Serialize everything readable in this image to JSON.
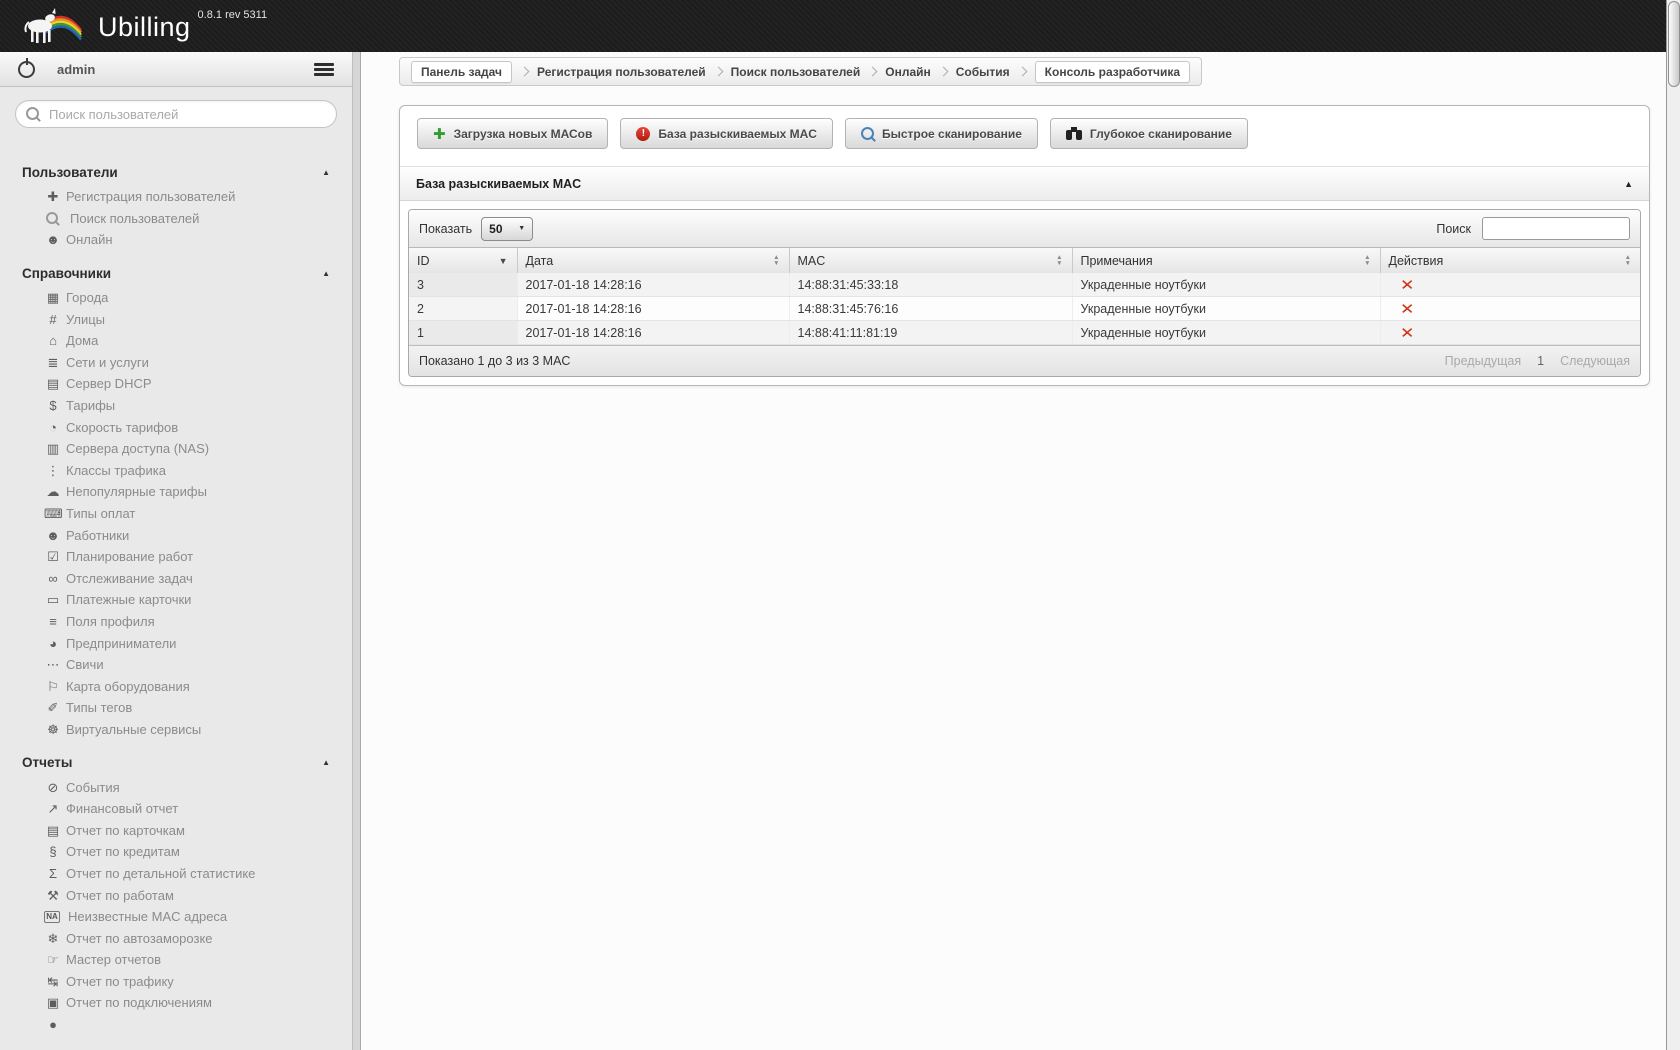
{
  "app": {
    "name": "Ubilling",
    "version": "0.8.1 rev 5311",
    "logo_icon": "unicorn-rainbow-logo"
  },
  "userbar": {
    "username": "admin",
    "power_icon": "power-icon",
    "menu_icon": "hamburger-icon"
  },
  "sidebar": {
    "search_placeholder": "Поиск пользователей",
    "sections": [
      {
        "title": "Пользователи",
        "items": [
          {
            "icon": "user-add-icon",
            "glyph": "✚",
            "label": "Регистрация пользователей"
          },
          {
            "icon": "user-search-icon",
            "type": "mag",
            "label": "Поиск пользователей"
          },
          {
            "icon": "users-online-icon",
            "glyph": "☻",
            "label": "Онлайн"
          }
        ]
      },
      {
        "title": "Справочники",
        "items": [
          {
            "icon": "city-icon",
            "glyph": "▦",
            "label": "Города"
          },
          {
            "icon": "streets-icon",
            "glyph": "#",
            "label": "Улицы"
          },
          {
            "icon": "house-icon",
            "glyph": "⌂",
            "label": "Дома"
          },
          {
            "icon": "networks-icon",
            "glyph": "≣",
            "label": "Сети и услуги"
          },
          {
            "icon": "dhcp-server-icon",
            "glyph": "▤",
            "label": "Сервер DHCP"
          },
          {
            "icon": "tariffs-icon",
            "glyph": "$",
            "label": "Тарифы"
          },
          {
            "icon": "tariff-speed-icon",
            "glyph": "◔",
            "label": "Скорость тарифов"
          },
          {
            "icon": "nas-servers-icon",
            "glyph": "▥",
            "label": "Сервера доступа (NAS)"
          },
          {
            "icon": "traffic-classes-icon",
            "glyph": "⋮",
            "label": "Классы трафика"
          },
          {
            "icon": "unpopular-tariffs-icon",
            "glyph": "☁",
            "label": "Непопулярные тарифы"
          },
          {
            "icon": "payment-types-icon",
            "glyph": "⌨",
            "label": "Типы оплат"
          },
          {
            "icon": "employees-icon",
            "glyph": "☻",
            "label": "Работники"
          },
          {
            "icon": "work-planning-icon",
            "glyph": "☑",
            "label": "Планирование работ"
          },
          {
            "icon": "task-tracking-icon",
            "glyph": "∞",
            "label": "Отслеживание задач"
          },
          {
            "icon": "payment-cards-icon",
            "glyph": "▭",
            "label": "Платежные карточки"
          },
          {
            "icon": "profile-fields-icon",
            "glyph": "≡",
            "label": "Поля профиля"
          },
          {
            "icon": "entrepreneurs-icon",
            "glyph": "◕",
            "label": "Предприниматели"
          },
          {
            "icon": "switches-icon",
            "glyph": "⋯",
            "label": "Свичи"
          },
          {
            "icon": "equipment-map-icon",
            "glyph": "⚐",
            "label": "Карта оборудования"
          },
          {
            "icon": "tag-types-icon",
            "glyph": "✐",
            "label": "Типы тегов"
          },
          {
            "icon": "virtual-services-icon",
            "glyph": "☸",
            "label": "Виртуальные сервисы"
          }
        ]
      },
      {
        "title": "Отчеты",
        "items": [
          {
            "icon": "events-icon",
            "glyph": "⊘",
            "label": "События"
          },
          {
            "icon": "finance-report-icon",
            "glyph": "↗",
            "label": "Финансовый отчет"
          },
          {
            "icon": "cards-report-icon",
            "glyph": "▤",
            "label": "Отчет по карточкам"
          },
          {
            "icon": "credits-report-icon",
            "glyph": "§",
            "label": "Отчет по кредитам"
          },
          {
            "icon": "detailed-stats-icon",
            "glyph": "Σ",
            "label": "Отчет по детальной статистике"
          },
          {
            "icon": "works-report-icon",
            "glyph": "⚒",
            "label": "Отчет по работам"
          },
          {
            "icon": "unknown-mac-icon",
            "type": "na",
            "glyph": "NA",
            "label": "Неизвестные MAC адреса"
          },
          {
            "icon": "autofreeze-report-icon",
            "glyph": "❄",
            "label": "Отчет по автозаморозке"
          },
          {
            "icon": "report-master-icon",
            "glyph": "☞",
            "label": "Мастер отчетов"
          },
          {
            "icon": "traffic-report-icon",
            "glyph": "↹",
            "label": "Отчет по трафику"
          },
          {
            "icon": "connections-report-icon",
            "glyph": "▣",
            "label": "Отчет по подключениям"
          },
          {
            "icon": "partial-item-icon",
            "glyph": "●",
            "label": ""
          }
        ]
      }
    ]
  },
  "breadcrumbs": {
    "items": [
      {
        "label": "Панель задач",
        "boxed": true
      },
      {
        "label": "Регистрация пользователей"
      },
      {
        "label": "Поиск пользователей"
      },
      {
        "label": "Онлайн"
      },
      {
        "label": "События"
      },
      {
        "label": "Консоль разработчика",
        "boxed": true
      }
    ]
  },
  "toolbar": {
    "buttons": [
      {
        "icon": "add-macs-icon",
        "type": "plus",
        "label": "Загрузка новых МАСов"
      },
      {
        "icon": "alert-icon",
        "type": "alert",
        "label": "База разыскиваемых MAC"
      },
      {
        "icon": "quick-scan-icon",
        "type": "mag",
        "label": "Быстрое сканирование"
      },
      {
        "icon": "deep-scan-icon",
        "type": "binoc",
        "label": "Глубокое сканирование"
      }
    ]
  },
  "panel": {
    "title": "База разыскиваемых MAC",
    "collapse_icon": "collapse-up-icon"
  },
  "table": {
    "show_label": "Показать",
    "page_size": "50",
    "search_label": "Поиск",
    "search_value": "",
    "columns": [
      {
        "label": "ID",
        "sort": "desc"
      },
      {
        "label": "Дата",
        "sort": "both"
      },
      {
        "label": "MAC",
        "sort": "both"
      },
      {
        "label": "Примечания",
        "sort": "both"
      },
      {
        "label": "Действия",
        "sort": "both"
      }
    ],
    "rows": [
      {
        "id": "3",
        "date": "2017-01-18 14:28:16",
        "mac": "14:88:31:45:33:18",
        "note": "Украденные ноутбуки"
      },
      {
        "id": "2",
        "date": "2017-01-18 14:28:16",
        "mac": "14:88:31:45:76:16",
        "note": "Украденные ноутбуки"
      },
      {
        "id": "1",
        "date": "2017-01-18 14:28:16",
        "mac": "14:88:41:11:81:19",
        "note": "Украденные ноутбуки"
      }
    ],
    "footer": {
      "info": "Показано 1 до 3 из 3 MAC",
      "prev": "Предыдущая",
      "page": "1",
      "next": "Следующая"
    }
  },
  "colors": {
    "delete_x": "#cf3417",
    "add_green": "#2f9e2f",
    "alert_red": "#b01a10",
    "topbar": "#1c1c1c",
    "sidebar_bg": "#e9e9e9"
  }
}
